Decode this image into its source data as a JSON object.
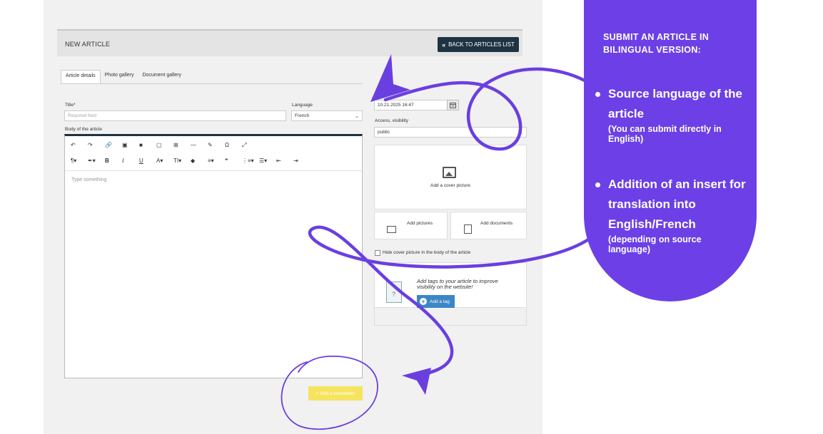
{
  "header": {
    "title": "NEW ARTICLE",
    "back_label": "BACK TO ARTICLES LIST",
    "back_icon": "double-chevron-left-icon"
  },
  "tabs": [
    {
      "label": "Article details",
      "active": true
    },
    {
      "label": "Photo gallery",
      "active": false
    },
    {
      "label": "Document gallery",
      "active": false
    }
  ],
  "form": {
    "title_label": "Title*",
    "title_placeholder": "Required field",
    "language_label": "Language",
    "language_value": "French",
    "body_label": "Body of the article",
    "body_placeholder": "Type something",
    "add_translation_label": "+ Add a translation"
  },
  "toolbar": {
    "row1": [
      "↶",
      "↷",
      "🔗",
      "▣",
      "■",
      "▢",
      "⊞",
      "—",
      "✎",
      "Ω",
      "⤢"
    ],
    "row2": [
      "¶▾",
      "✒▾",
      "B",
      "I",
      "U",
      "A▾",
      "TI▾",
      "◆",
      "≡▾",
      "❝",
      "⋮≡▾",
      "☰▾",
      "⇤",
      "⇥"
    ]
  },
  "sidebar": {
    "date_value": "10.21.2025 16:47",
    "access_label": "Access, visibility",
    "access_value": "public",
    "cover_label": "Add a cover picture",
    "add_pictures_label": "Add pictures",
    "add_documents_label": "Add documents",
    "hide_cover_label": "Hide cover picture in the body of the article",
    "tags_text": "Add tags to your article to improve visibility on the website!",
    "add_tag_label": "Add a tag"
  },
  "callout": {
    "heading": "SUBMIT AN ARTICLE IN BILINGUAL VERSION:",
    "bullet1_main": "Source language of the article",
    "bullet1_sub": "(You can submit directly in English)",
    "bullet2_main": "Addition of an insert for translation into English/French",
    "bullet2_sub": "(depending on source language)"
  },
  "colors": {
    "callout_purple": "#6c40e6",
    "annotation_purple": "#6a3fe0",
    "back_button": "#1e3342",
    "translate_button": "#f6e45f",
    "tag_button": "#3b86c6"
  }
}
